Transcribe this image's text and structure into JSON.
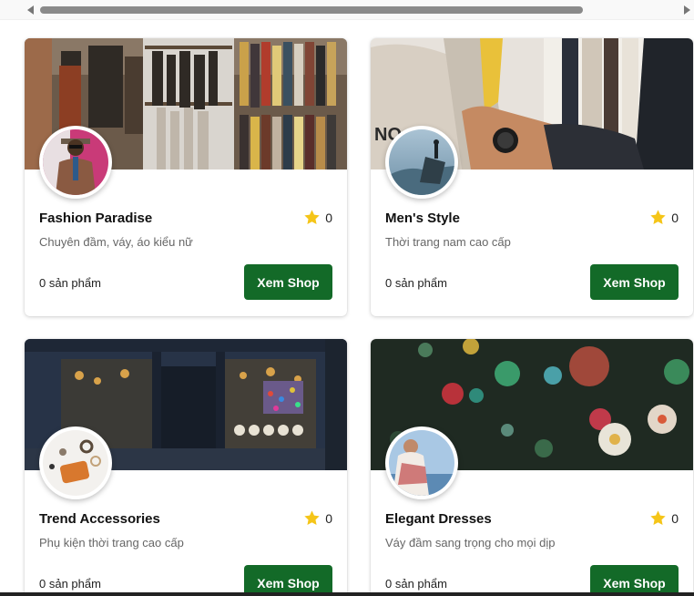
{
  "shops": [
    {
      "name": "Fashion Paradise",
      "rating": "0",
      "description": "Chuyên đầm, váy, áo kiểu nữ",
      "product_count": "0 sản phẩm",
      "button_label": "Xem Shop"
    },
    {
      "name": "Men's Style",
      "rating": "0",
      "description": "Thời trang nam cao cấp",
      "product_count": "0 sản phẩm",
      "button_label": "Xem Shop"
    },
    {
      "name": "Trend Accessories",
      "rating": "0",
      "description": "Phụ kiện thời trang cao cấp",
      "product_count": "0 sản phẩm",
      "button_label": "Xem Shop"
    },
    {
      "name": "Elegant Dresses",
      "rating": "0",
      "description": "Váy đầm sang trọng cho mọi dịp",
      "product_count": "0 sản phẩm",
      "button_label": "Xem Shop"
    }
  ],
  "colors": {
    "button_bg": "#136a28",
    "star": "#f5c518"
  },
  "icons": {
    "rating": "star-icon",
    "scroll_left": "scroll-left-arrow-icon",
    "scroll_right": "scroll-right-arrow-icon"
  }
}
